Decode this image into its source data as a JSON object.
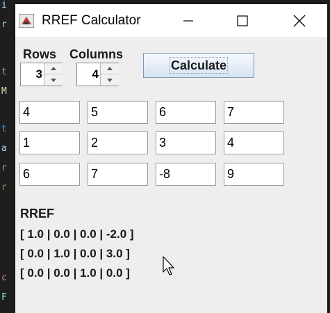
{
  "window": {
    "title": "RREF Calculator",
    "icon": "java-app-icon",
    "controls": [
      "minimize-icon",
      "maximize-icon",
      "close-icon"
    ]
  },
  "controls": {
    "rows_label": "Rows",
    "columns_label": "Columns",
    "rows_value": "3",
    "columns_value": "4",
    "calculate_label": "Calculate"
  },
  "matrix": [
    [
      "4",
      "5",
      "6",
      "7"
    ],
    [
      "1",
      "2",
      "3",
      "4"
    ],
    [
      "6",
      "7",
      "-8",
      "9"
    ]
  ],
  "result": {
    "title": "RREF",
    "rows": [
      "[ 1.0 | 0.0 | 0.0 | -2.0 ]",
      "[ 0.0 | 1.0 | 0.0 | 3.0 ]",
      "[ 0.0 | 0.0 | 1.0 | 0.0 ]"
    ]
  }
}
